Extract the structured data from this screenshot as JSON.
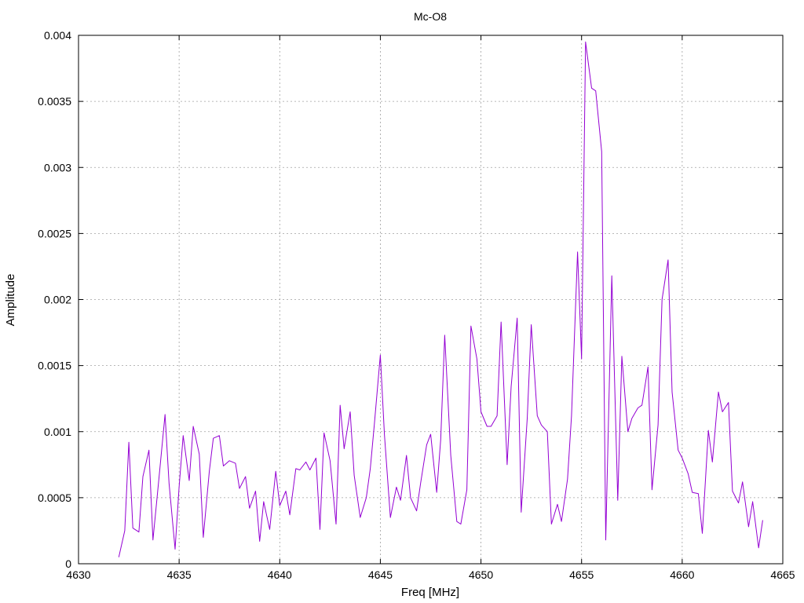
{
  "chart_data": {
    "type": "line",
    "title": "Mc-O8",
    "xlabel": "Freq [MHz]",
    "ylabel": "Amplitude",
    "xlim": [
      4630,
      4665
    ],
    "ylim": [
      0,
      0.004
    ],
    "x_ticks": [
      4630,
      4635,
      4640,
      4645,
      4650,
      4655,
      4660,
      4665
    ],
    "x_tick_labels": [
      "4630",
      "4635",
      "4640",
      "4645",
      "4650",
      "4655",
      "4660",
      "4665"
    ],
    "y_ticks": [
      0,
      0.0005,
      0.001,
      0.0015,
      0.002,
      0.0025,
      0.003,
      0.0035,
      0.004
    ],
    "y_tick_labels": [
      "0",
      "0.0005",
      "0.001",
      "0.0015",
      "0.002",
      "0.0025",
      "0.003",
      "0.0035",
      "0.004"
    ],
    "grid": true,
    "legend": "none",
    "series": [
      {
        "color": "#9400d3",
        "x": [
          4632.0,
          4632.3,
          4632.5,
          4632.7,
          4633.0,
          4633.2,
          4633.5,
          4633.7,
          4634.0,
          4634.3,
          4634.5,
          4634.8,
          4635.0,
          4635.2,
          4635.5,
          4635.7,
          4636.0,
          4636.2,
          4636.5,
          4636.7,
          4637.0,
          4637.2,
          4637.5,
          4637.8,
          4638.0,
          4638.3,
          4638.5,
          4638.8,
          4639.0,
          4639.2,
          4639.5,
          4639.8,
          4640.0,
          4640.3,
          4640.5,
          4640.8,
          4641.0,
          4641.3,
          4641.5,
          4641.8,
          4642.0,
          4642.2,
          4642.5,
          4642.8,
          4643.0,
          4643.2,
          4643.5,
          4643.7,
          4644.0,
          4644.3,
          4644.5,
          4644.7,
          4645.0,
          4645.2,
          4645.5,
          4645.8,
          4646.0,
          4646.3,
          4646.5,
          4646.8,
          4647.0,
          4647.3,
          4647.5,
          4647.8,
          4648.0,
          4648.2,
          4648.5,
          4648.8,
          4649.0,
          4649.3,
          4649.5,
          4649.8,
          4650.0,
          4650.3,
          4650.5,
          4650.8,
          4651.0,
          4651.3,
          4651.5,
          4651.8,
          4652.0,
          4652.3,
          4652.5,
          4652.8,
          4653.0,
          4653.3,
          4653.5,
          4653.8,
          4654.0,
          4654.3,
          4654.5,
          4654.8,
          4655.0,
          4655.2,
          4655.5,
          4655.7,
          4656.0,
          4656.2,
          4656.5,
          4656.8,
          4657.0,
          4657.3,
          4657.5,
          4657.8,
          4658.0,
          4658.3,
          4658.5,
          4658.8,
          4659.0,
          4659.3,
          4659.5,
          4659.8,
          4660.0,
          4660.3,
          4660.5,
          4660.8,
          4661.0,
          4661.3,
          4661.5,
          4661.8,
          4662.0,
          4662.3,
          4662.5,
          4662.8,
          4663.0,
          4663.3,
          4663.5,
          4663.8,
          4664.0
        ],
        "y": [
          5e-05,
          0.00025,
          0.00092,
          0.00027,
          0.00024,
          0.00066,
          0.00086,
          0.00018,
          0.00065,
          0.00113,
          0.00061,
          0.00011,
          0.00058,
          0.00097,
          0.00063,
          0.00104,
          0.00083,
          0.0002,
          0.0007,
          0.00095,
          0.00097,
          0.00074,
          0.00078,
          0.00076,
          0.00057,
          0.00066,
          0.00042,
          0.00055,
          0.00017,
          0.00047,
          0.00026,
          0.0007,
          0.00044,
          0.00055,
          0.00037,
          0.00072,
          0.00071,
          0.00077,
          0.00071,
          0.0008,
          0.00026,
          0.00099,
          0.00078,
          0.0003,
          0.0012,
          0.00087,
          0.00115,
          0.00067,
          0.00035,
          0.0005,
          0.00072,
          0.00105,
          0.00158,
          0.00098,
          0.00035,
          0.00058,
          0.00048,
          0.00082,
          0.0005,
          0.0004,
          0.00061,
          0.0009,
          0.00098,
          0.00054,
          0.00094,
          0.00173,
          0.00082,
          0.00032,
          0.0003,
          0.00056,
          0.0018,
          0.00155,
          0.00115,
          0.00104,
          0.00104,
          0.00112,
          0.00183,
          0.00075,
          0.00134,
          0.00186,
          0.00039,
          0.0011,
          0.00181,
          0.00112,
          0.00105,
          0.001,
          0.0003,
          0.00045,
          0.00032,
          0.00064,
          0.00112,
          0.00236,
          0.00155,
          0.00395,
          0.0036,
          0.00358,
          0.00312,
          0.00018,
          0.00218,
          0.00048,
          0.00157,
          0.001,
          0.0011,
          0.00118,
          0.0012,
          0.00149,
          0.00056,
          0.00105,
          0.002,
          0.0023,
          0.0013,
          0.00086,
          0.0008,
          0.00068,
          0.00054,
          0.00053,
          0.00023,
          0.00101,
          0.00077,
          0.0013,
          0.00115,
          0.00122,
          0.00055,
          0.00046,
          0.00062,
          0.00028,
          0.00047,
          0.00012,
          0.00033
        ]
      }
    ]
  }
}
